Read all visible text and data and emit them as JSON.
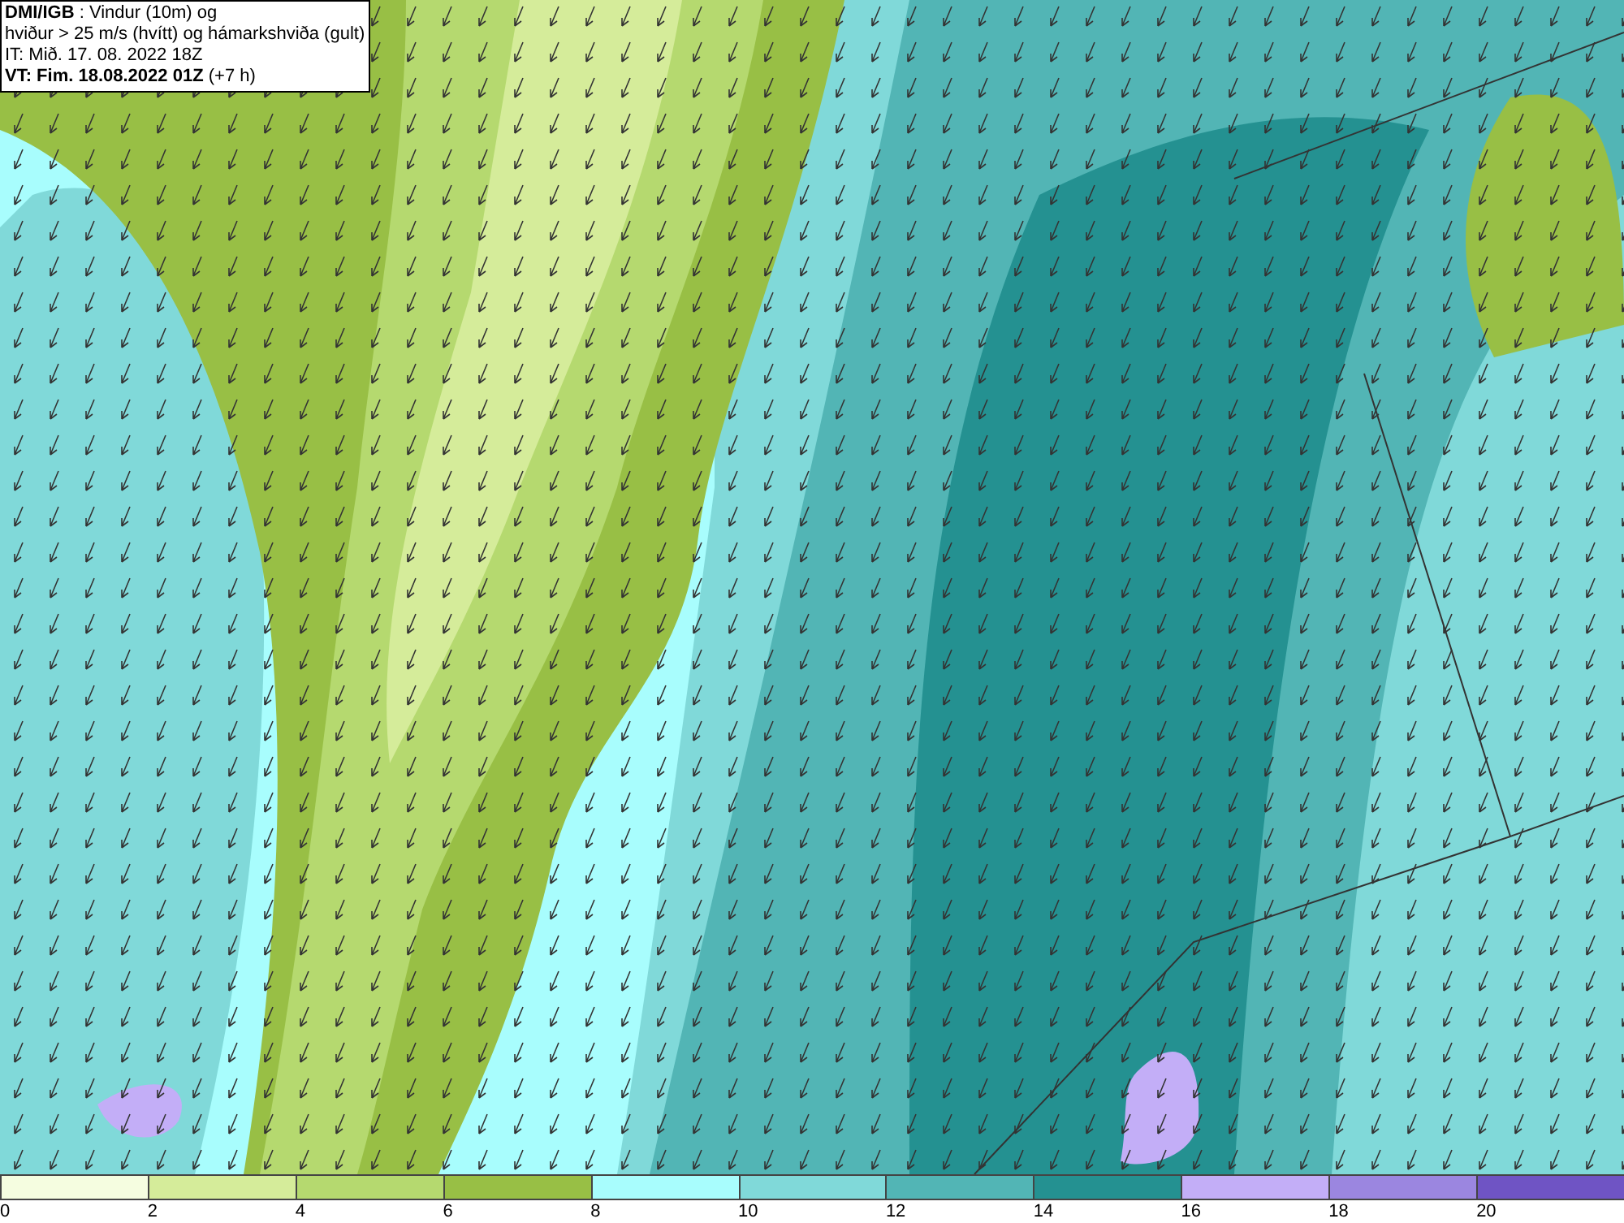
{
  "header": {
    "lines": [
      "**DMI/IGB** : Vindur (10m) og",
      "hviður > 25 m/s (hvítt) og hámarkshviða (gult)",
      "IT: Mið. 17. 08. 2022 18Z",
      "**VT: Fim. 18.08.2022 01Z** (+7 h)"
    ]
  },
  "legend": [
    {
      "label": "0",
      "color": "#f5fde0"
    },
    {
      "label": "2",
      "color": "#d5ec9a"
    },
    {
      "label": "4",
      "color": "#b5d96f"
    },
    {
      "label": "6",
      "color": "#98bf45"
    },
    {
      "label": "8",
      "color": "#a8fdfd"
    },
    {
      "label": "10",
      "color": "#80d9d9"
    },
    {
      "label": "12",
      "color": "#52b5b5"
    },
    {
      "label": "14",
      "color": "#249191"
    },
    {
      "label": "16",
      "color": "#c3aef7"
    },
    {
      "label": "18",
      "color": "#9b86e0"
    },
    {
      "label": "20",
      "color": "#6f54c4"
    }
  ]
}
